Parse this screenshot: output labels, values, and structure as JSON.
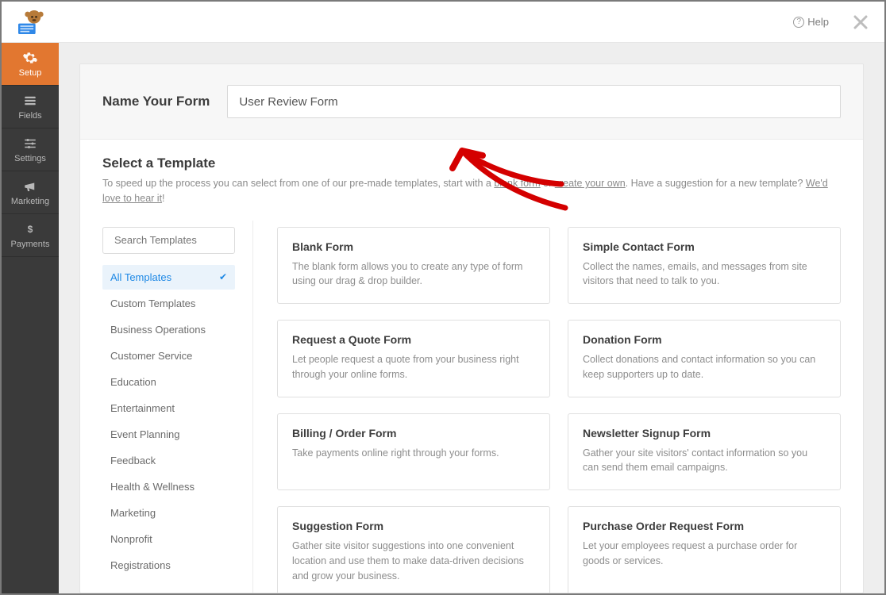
{
  "topbar": {
    "help_label": "Help"
  },
  "rail": {
    "items": [
      {
        "label": "Setup"
      },
      {
        "label": "Fields"
      },
      {
        "label": "Settings"
      },
      {
        "label": "Marketing"
      },
      {
        "label": "Payments"
      }
    ]
  },
  "name_section": {
    "label": "Name Your Form",
    "value": "User Review Form"
  },
  "template_section": {
    "heading": "Select a Template",
    "helper_pre": "To speed up the process you can select from one of our pre-made templates, start with a ",
    "helper_link1": "blank form",
    "helper_mid": " or ",
    "helper_link2": "create your own",
    "helper_post1": ". Have a suggestion for a new template? ",
    "helper_link3": "We'd love to hear it",
    "helper_post2": "!"
  },
  "search": {
    "placeholder": "Search Templates"
  },
  "categories": [
    "All Templates",
    "Custom Templates",
    "Business Operations",
    "Customer Service",
    "Education",
    "Entertainment",
    "Event Planning",
    "Feedback",
    "Health & Wellness",
    "Marketing",
    "Nonprofit",
    "Registrations"
  ],
  "templates": [
    {
      "title": "Blank Form",
      "desc": "The blank form allows you to create any type of form using our drag & drop builder."
    },
    {
      "title": "Simple Contact Form",
      "desc": "Collect the names, emails, and messages from site visitors that need to talk to you."
    },
    {
      "title": "Request a Quote Form",
      "desc": "Let people request a quote from your business right through your online forms."
    },
    {
      "title": "Donation Form",
      "desc": "Collect donations and contact information so you can keep supporters up to date."
    },
    {
      "title": "Billing / Order Form",
      "desc": "Take payments online right through your forms."
    },
    {
      "title": "Newsletter Signup Form",
      "desc": "Gather your site visitors' contact information so you can send them email campaigns."
    },
    {
      "title": "Suggestion Form",
      "desc": "Gather site visitor suggestions into one convenient location and use them to make data-driven decisions and grow your business."
    },
    {
      "title": "Purchase Order Request Form",
      "desc": "Let your employees request a purchase order for goods or services."
    }
  ]
}
